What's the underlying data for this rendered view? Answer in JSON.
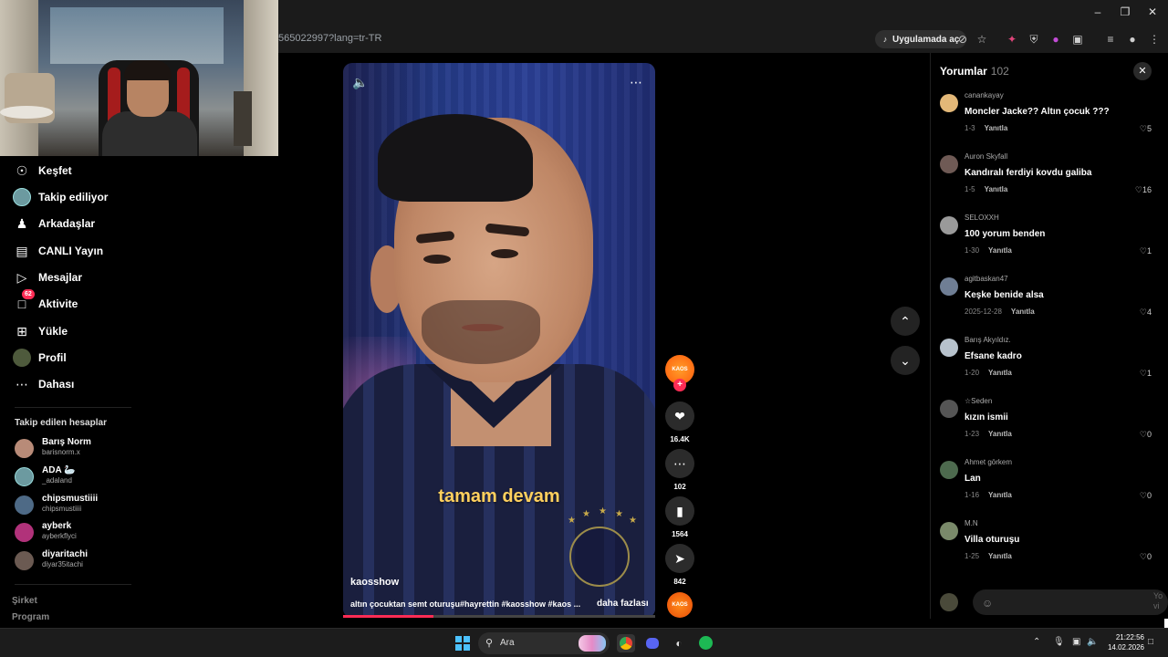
{
  "browser": {
    "url_fragment": "565022997?lang=tr-TR",
    "open_in_app_label": "Uygulamada aç",
    "window_controls": [
      "minimize-icon",
      "restore-icon",
      "close-icon"
    ]
  },
  "nav": {
    "items": [
      {
        "label": "Keşfet",
        "icon": "compass-icon"
      },
      {
        "label": "Takip ediliyor",
        "icon": "following-avatar"
      },
      {
        "label": "Arkadaşlar",
        "icon": "friends-icon"
      },
      {
        "label": "CANLI Yayın",
        "icon": "live-icon"
      },
      {
        "label": "Mesajlar",
        "icon": "send-icon"
      },
      {
        "label": "Aktivite",
        "icon": "activity-icon",
        "badge": "62"
      },
      {
        "label": "Yükle",
        "icon": "upload-icon"
      },
      {
        "label": "Profil",
        "icon": "profile-avatar"
      },
      {
        "label": "Dahası",
        "icon": "more-icon"
      }
    ],
    "following_title": "Takip edilen hesaplar",
    "following": [
      {
        "name": "Barış Norm",
        "handle": "barisnorm.x",
        "color": "#b88b78"
      },
      {
        "name": "ADA 🦢",
        "handle": "_adaland",
        "color": "#6c9aa0"
      },
      {
        "name": "chipsmustiiii",
        "handle": "chipsmustiiii",
        "color": "#4e6a86"
      },
      {
        "name": "ayberk",
        "handle": "ayberkflyci",
        "color": "#b1327a"
      },
      {
        "name": "diyaritachi",
        "handle": "diyar35itachi",
        "color": "#6b5a52"
      }
    ],
    "footer": [
      "Şirket",
      "Program"
    ]
  },
  "video": {
    "caption": "tamam devam",
    "author": "kaosshow",
    "description": "altın çocuktan semt oturuşu#hayrettin #kaosshow #kaos ...",
    "more_label": "daha fazlası",
    "progress": 0.29,
    "sound_icon": "volume-icon",
    "menu_icon": "more-horizontal-icon"
  },
  "actions": {
    "creator_badge": "KAOS",
    "likes": "16.4K",
    "comments": "102",
    "saves": "1564",
    "shares": "842"
  },
  "comments_panel": {
    "title": "Yorumlar",
    "count": "102",
    "reply_label": "Yanıtla",
    "comments": [
      {
        "user": "canankayay",
        "text": "Moncler Jacke?? Altın çocuk ???",
        "date": "1-3",
        "likes": "5",
        "color": "#e3b878"
      },
      {
        "user": "Auron Skyfall",
        "text": "Kandıralı ferdiyi kovdu galiba",
        "date": "1-5",
        "likes": "16",
        "color": "#6f5a55"
      },
      {
        "user": "SELOXXH",
        "text": "100 yorum benden",
        "date": "1-30",
        "likes": "1",
        "color": "#9a9a9a"
      },
      {
        "user": "agitbaskan47",
        "text": "Keşke benide alsa",
        "date": "2025-12-28",
        "likes": "4",
        "color": "#6f7e94"
      },
      {
        "user": "Barış Akyıldız.",
        "text": "Efsane kadro",
        "date": "1-20",
        "likes": "1",
        "color": "#b7c2cc"
      },
      {
        "user": "☆Seden",
        "text": "kızın ismii",
        "date": "1-23",
        "likes": "0",
        "color": "#555555"
      },
      {
        "user": "Ahmet görkem",
        "text": "Lan",
        "date": "1-16",
        "likes": "0",
        "color": "#4d6a4e"
      },
      {
        "user": "M.N",
        "text": "Villa oturuşu",
        "date": "1-25",
        "likes": "0",
        "color": "#7a8a6a"
      }
    ],
    "input_emoji_icon": "emoji-icon",
    "send_hint": "Yo vi"
  },
  "taskbar": {
    "search_label": "Ara",
    "apps": [
      "chrome-icon",
      "discord-icon",
      "obs-icon",
      "spotify-icon"
    ],
    "time": "21:22:56",
    "date": "14.02.2026"
  }
}
